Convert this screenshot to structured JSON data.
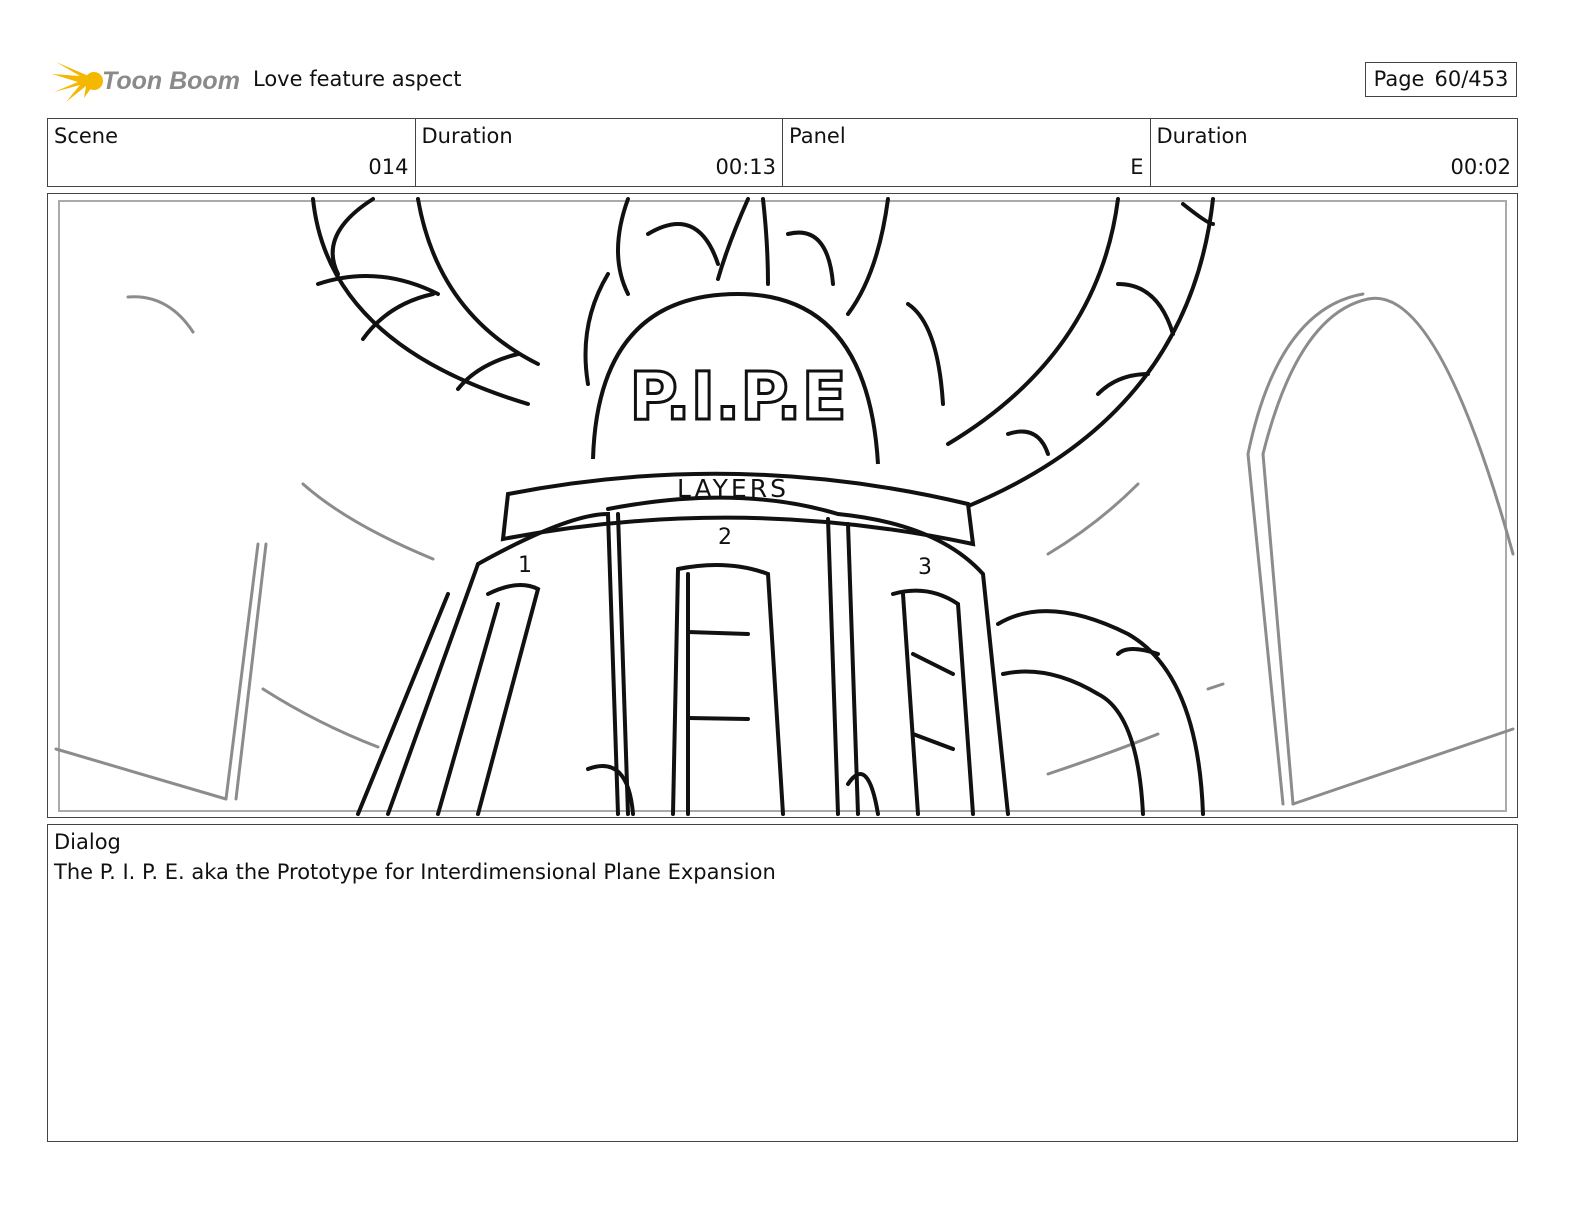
{
  "header": {
    "logo_text": "Toon Boom",
    "title": "Love feature aspect",
    "page_label": "Page",
    "page_value": "60/453"
  },
  "info": {
    "scene_label": "Scene",
    "scene_value": "014",
    "scene_duration_label": "Duration",
    "scene_duration_value": "00:13",
    "panel_label": "Panel",
    "panel_value": "E",
    "panel_duration_label": "Duration",
    "panel_duration_value": "00:02"
  },
  "drawing": {
    "dome_text": "P.I.P.E",
    "band_text": "LAYERS",
    "door_numbers": [
      "1",
      "2",
      "3"
    ]
  },
  "dialog": {
    "label": "Dialog",
    "text": "The P. I. P. E. aka the Prototype for Interdimensional Plane Expansion"
  },
  "colors": {
    "logo_yellow": "#f5b800",
    "logo_text": "#8a8a8a",
    "sketch_black": "#111111",
    "sketch_gray": "#8c8c8c"
  }
}
